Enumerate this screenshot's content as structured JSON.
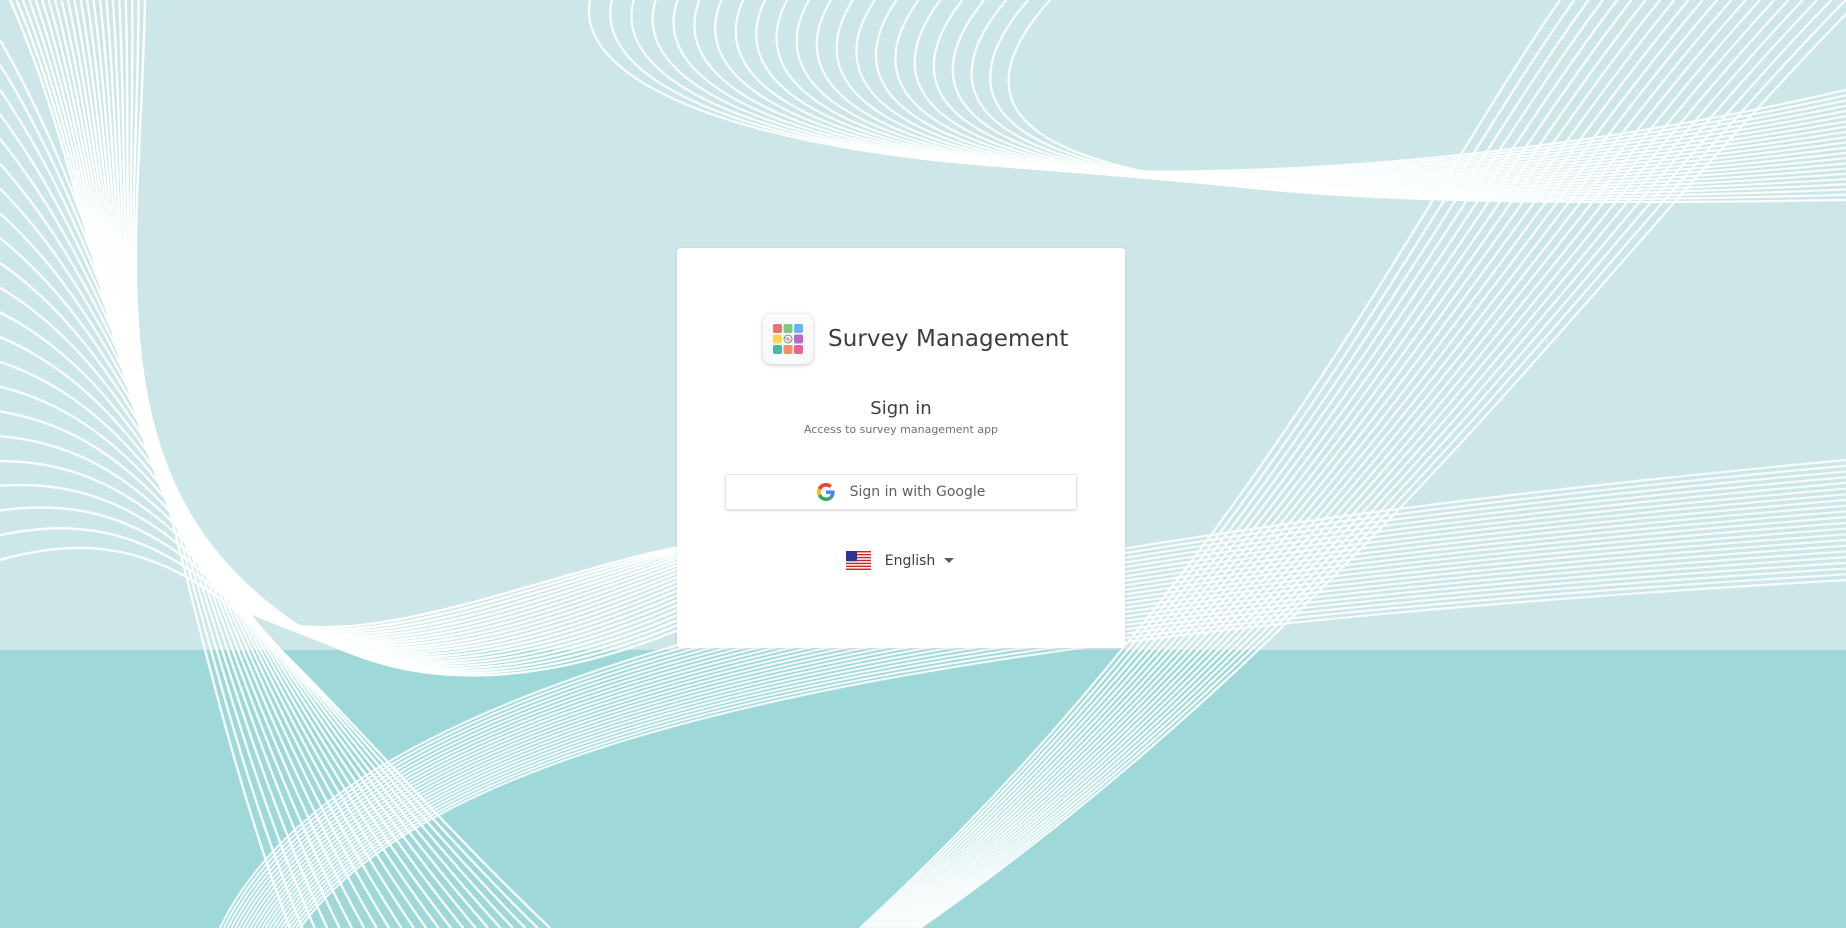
{
  "app": {
    "title": "Survey Management",
    "logo_icon": "survey-app-logo"
  },
  "signin": {
    "title": "Sign in",
    "subtitle": "Access to survey management app"
  },
  "google_button": {
    "label": "Sign in with Google",
    "icon": "google-g-icon"
  },
  "language": {
    "selected": "English",
    "flag_icon": "us-flag-icon",
    "dropdown_icon": "caret-down-icon"
  },
  "colors": {
    "background_top": "#cde6e8",
    "background_bottom": "#9ed8d9",
    "card": "#ffffff",
    "text_primary": "#3d3d3d"
  }
}
